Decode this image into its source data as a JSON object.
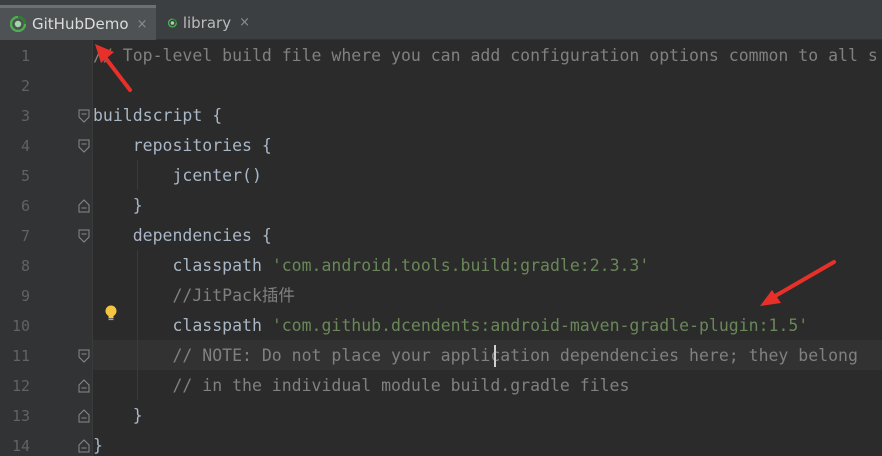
{
  "tabs": [
    {
      "label": "GitHubDemo",
      "close": "×",
      "active": true
    },
    {
      "label": "library",
      "close": "×",
      "active": false
    }
  ],
  "gutter": {
    "line_numbers": [
      "1",
      "2",
      "3",
      "4",
      "5",
      "6",
      "7",
      "8",
      "9",
      "10",
      "11",
      "12",
      "13",
      "14"
    ]
  },
  "code": {
    "l1": "// Top-level build file where you can add configuration options common to all s",
    "l3": "buildscript {",
    "l4": "    repositories {",
    "l5": "        jcenter()",
    "l6": "    }",
    "l7": "    dependencies {",
    "l8_kw": "        classpath ",
    "l8_str": "'com.android.tools.build:gradle:2.3.3'",
    "l9": "        //JitPack插件",
    "l10_kw": "        classpath ",
    "l10_str": "'com.github.dcendents:android-maven-gradle-plugin:1.5'",
    "l11": "        // NOTE: Do not place your application dependencies here; they belong",
    "l12": "        // in the individual module build.gradle files",
    "l13": "    }",
    "l14": "}"
  },
  "colors": {
    "background": "#2b2b2b",
    "comment": "#808080",
    "string": "#6a8759",
    "identifier": "#a9b7c6",
    "annotation_arrow": "#e8302a",
    "tab_icon_green": "#4caf50"
  },
  "icons": {
    "tab_icon": "android-studio-project-icon",
    "bulb": "intention-bulb-icon",
    "fold": "code-fold-marker-icon"
  }
}
